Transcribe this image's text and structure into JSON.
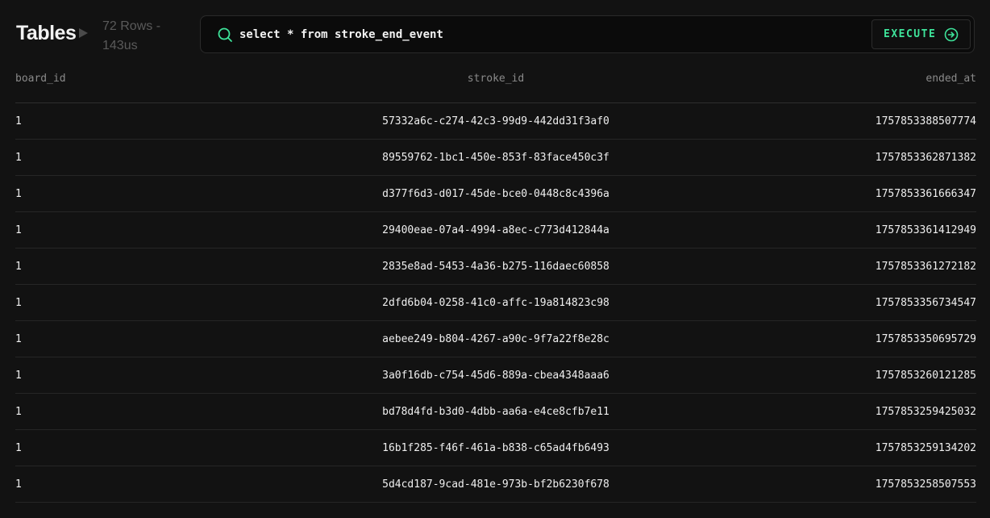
{
  "header": {
    "title": "Tables",
    "rows_label": "72 Rows -",
    "time_label": "143us"
  },
  "query": {
    "value": "select * from stroke_end_event",
    "execute_label": "EXECUTE"
  },
  "colors": {
    "background": "#121212",
    "accent": "#3ee39a",
    "muted": "#5a5a5a"
  },
  "table": {
    "columns": [
      "board_id",
      "stroke_id",
      "ended_at"
    ],
    "rows": [
      [
        "1",
        "57332a6c-c274-42c3-99d9-442dd31f3af0",
        "1757853388507774"
      ],
      [
        "1",
        "89559762-1bc1-450e-853f-83face450c3f",
        "1757853362871382"
      ],
      [
        "1",
        "d377f6d3-d017-45de-bce0-0448c8c4396a",
        "1757853361666347"
      ],
      [
        "1",
        "29400eae-07a4-4994-a8ec-c773d412844a",
        "1757853361412949"
      ],
      [
        "1",
        "2835e8ad-5453-4a36-b275-116daec60858",
        "1757853361272182"
      ],
      [
        "1",
        "2dfd6b04-0258-41c0-affc-19a814823c98",
        "1757853356734547"
      ],
      [
        "1",
        "aebee249-b804-4267-a90c-9f7a22f8e28c",
        "1757853350695729"
      ],
      [
        "1",
        "3a0f16db-c754-45d6-889a-cbea4348aaa6",
        "1757853260121285"
      ],
      [
        "1",
        "bd78d4fd-b3d0-4dbb-aa6a-e4ce8cfb7e11",
        "1757853259425032"
      ],
      [
        "1",
        "16b1f285-f46f-461a-b838-c65ad4fb6493",
        "1757853259134202"
      ],
      [
        "1",
        "5d4cd187-9cad-481e-973b-bf2b6230f678",
        "1757853258507553"
      ]
    ]
  }
}
